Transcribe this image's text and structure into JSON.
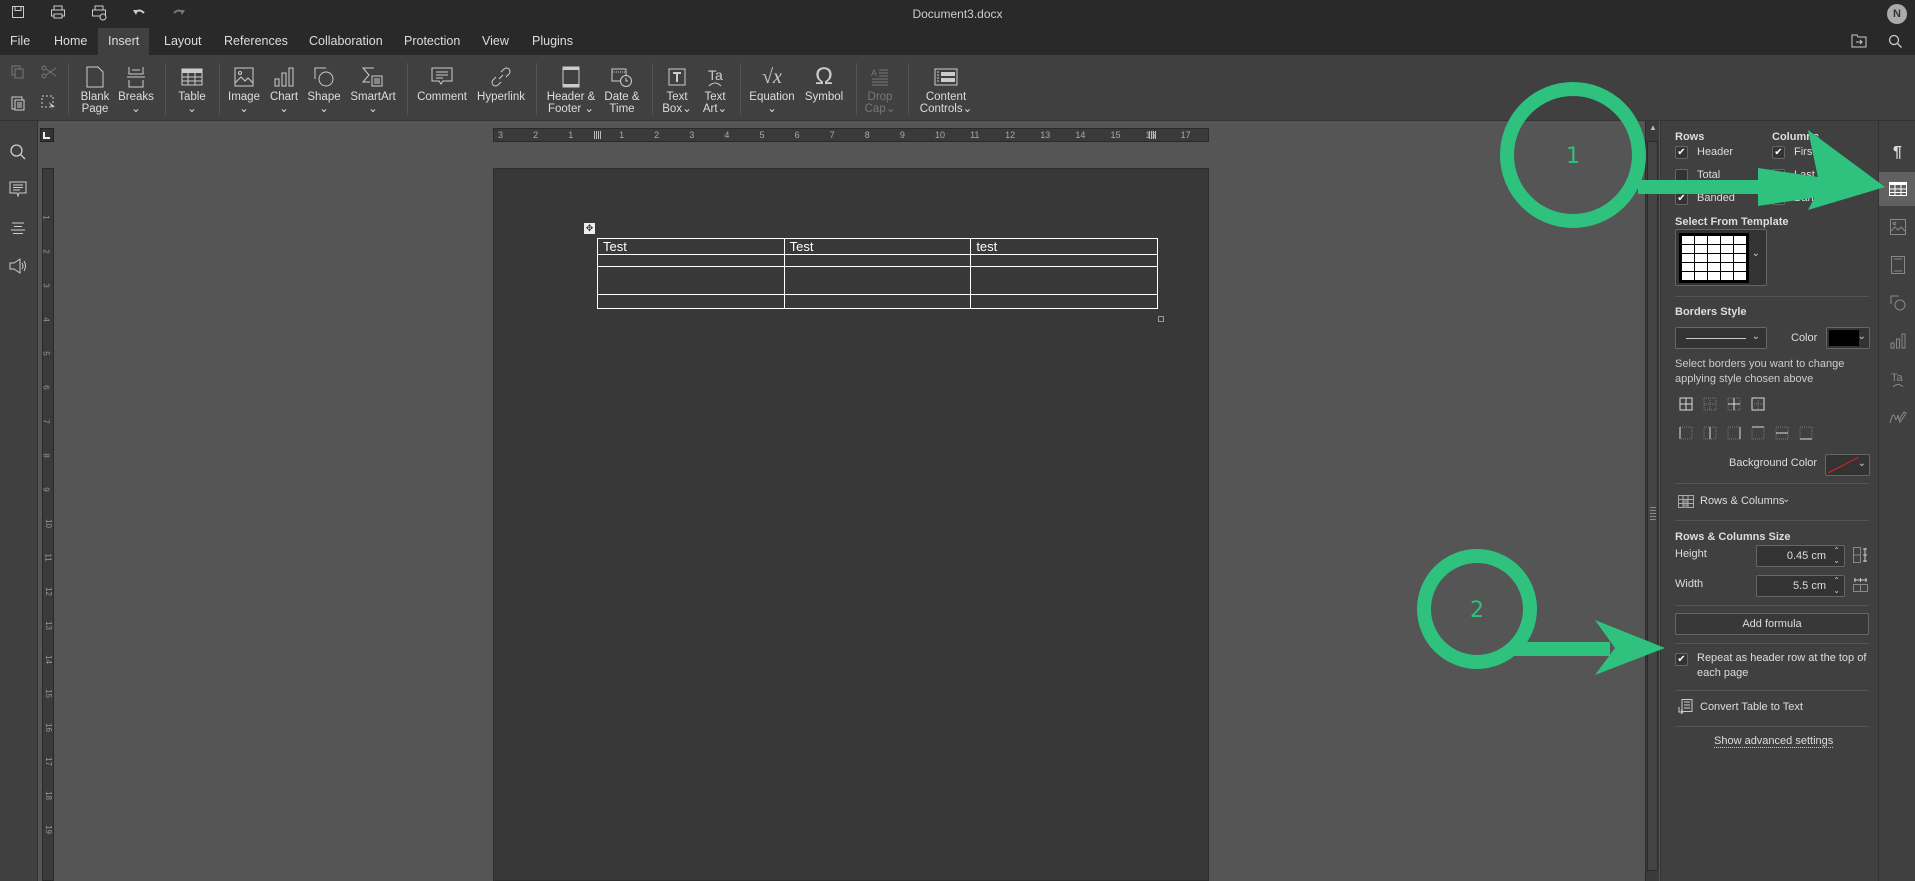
{
  "title_bar": {
    "doc_title": "Document3.docx",
    "avatar_initial": "N",
    "quick_access": [
      "save-icon",
      "print-icon",
      "quick-print-icon",
      "undo-icon",
      "redo-icon"
    ]
  },
  "menu": {
    "items": [
      "File",
      "Home",
      "Insert",
      "Layout",
      "References",
      "Collaboration",
      "Protection",
      "View",
      "Plugins"
    ],
    "active": "Insert"
  },
  "toolbar": {
    "blank_page": "Blank\nPage",
    "blank_page_1": "Blank",
    "blank_page_2": "Page",
    "breaks": "Breaks",
    "table": "Table",
    "image": "Image",
    "chart": "Chart",
    "shape": "Shape",
    "smartart": "SmartArt",
    "comment": "Comment",
    "hyperlink": "Hyperlink",
    "header_footer_1": "Header &",
    "header_footer_2": "Footer",
    "date_time_1": "Date &",
    "date_time_2": "Time",
    "text_box_1": "Text",
    "text_box_2": "Box",
    "text_art_1": "Text",
    "text_art_2": "Art",
    "equation": "Equation",
    "symbol": "Symbol",
    "drop_cap_1": "Drop",
    "drop_cap_2": "Cap",
    "content_controls_1": "Content",
    "content_controls_2": "Controls"
  },
  "ruler": {
    "labels": [
      "3",
      "2",
      "1",
      "1",
      "2",
      "3",
      "4",
      "5",
      "6",
      "7",
      "8",
      "9",
      "10",
      "11",
      "12",
      "13",
      "14",
      "15",
      "16",
      "17"
    ]
  },
  "document": {
    "table": [
      [
        "Test",
        "Test",
        "test"
      ],
      [
        "",
        "",
        ""
      ],
      [
        "",
        "",
        ""
      ],
      [
        "",
        "",
        ""
      ]
    ]
  },
  "panel": {
    "rows_label": "Rows",
    "columns_label": "Columns",
    "rows": [
      {
        "label": "Header",
        "checked": true
      },
      {
        "label": "Total",
        "checked": false
      },
      {
        "label": "Banded",
        "checked": true
      }
    ],
    "columns": [
      {
        "label": "First",
        "checked": true
      },
      {
        "label": "Last",
        "checked": false
      },
      {
        "label": "Banded",
        "checked": false
      }
    ],
    "template_label": "Select From Template",
    "borders_style_label": "Borders Style",
    "color_label": "Color",
    "border_color": "#000000",
    "borders_hint": "Select borders you want to change applying style chosen above",
    "background_color_label": "Background Color",
    "rows_columns_label": "Rows & Columns",
    "size_label": "Rows & Columns Size",
    "height_label": "Height",
    "height_value": "0.45 cm",
    "width_label": "Width",
    "width_value": "5.5 cm",
    "add_formula": "Add formula",
    "repeat_header_label": "Repeat as header row at the top of each page",
    "repeat_header_checked": true,
    "convert_label": "Convert Table to Text",
    "advanced_label": "Show advanced settings"
  },
  "annotations": {
    "color": "#2ec27e",
    "marker_1": "1",
    "marker_2": "2"
  }
}
